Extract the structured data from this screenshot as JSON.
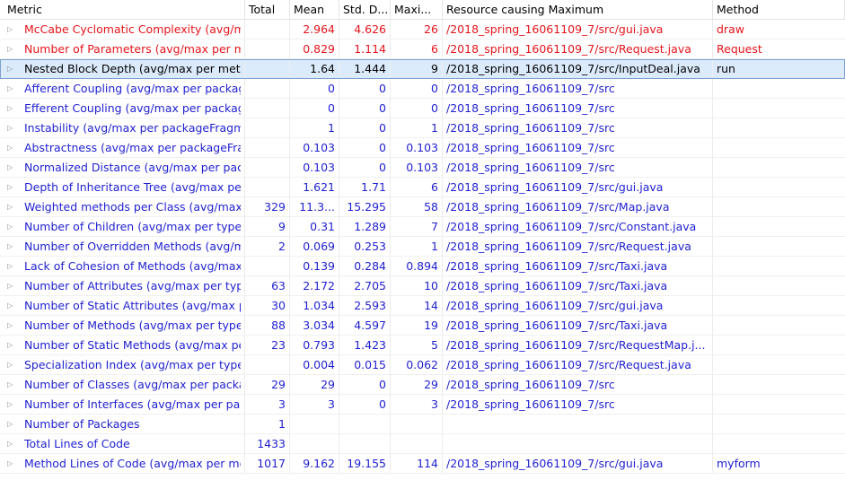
{
  "headers": {
    "metric": "Metric",
    "total": "Total",
    "mean": "Mean",
    "std": "Std. D...",
    "max": "Maxi...",
    "resource": "Resource causing Maximum",
    "method": "Method"
  },
  "rows": [
    {
      "metric": "McCabe Cyclomatic Complexity (avg/max per method)",
      "total": "",
      "mean": "2.964",
      "std": "4.626",
      "max": "26",
      "resource": "/2018_spring_16061109_7/src/gui.java",
      "method": "draw",
      "color": "red"
    },
    {
      "metric": "Number of Parameters (avg/max per method)",
      "total": "",
      "mean": "0.829",
      "std": "1.114",
      "max": "6",
      "resource": "/2018_spring_16061109_7/src/Request.java",
      "method": "Request",
      "color": "red"
    },
    {
      "metric": "Nested Block Depth (avg/max per method)",
      "total": "",
      "mean": "1.64",
      "std": "1.444",
      "max": "9",
      "resource": "/2018_spring_16061109_7/src/InputDeal.java",
      "method": "run",
      "color": "black",
      "selected": true
    },
    {
      "metric": "Afferent Coupling (avg/max per packageFragment)",
      "total": "",
      "mean": "0",
      "std": "0",
      "max": "0",
      "resource": "/2018_spring_16061109_7/src",
      "method": "",
      "color": "blue"
    },
    {
      "metric": "Efferent Coupling (avg/max per packageFragment)",
      "total": "",
      "mean": "0",
      "std": "0",
      "max": "0",
      "resource": "/2018_spring_16061109_7/src",
      "method": "",
      "color": "blue"
    },
    {
      "metric": "Instability (avg/max per packageFragment)",
      "total": "",
      "mean": "1",
      "std": "0",
      "max": "1",
      "resource": "/2018_spring_16061109_7/src",
      "method": "",
      "color": "blue"
    },
    {
      "metric": "Abstractness (avg/max per packageFragment)",
      "total": "",
      "mean": "0.103",
      "std": "0",
      "max": "0.103",
      "resource": "/2018_spring_16061109_7/src",
      "method": "",
      "color": "blue"
    },
    {
      "metric": "Normalized Distance (avg/max per packageFragment)",
      "total": "",
      "mean": "0.103",
      "std": "0",
      "max": "0.103",
      "resource": "/2018_spring_16061109_7/src",
      "method": "",
      "color": "blue"
    },
    {
      "metric": "Depth of Inheritance Tree (avg/max per type)",
      "total": "",
      "mean": "1.621",
      "std": "1.71",
      "max": "6",
      "resource": "/2018_spring_16061109_7/src/gui.java",
      "method": "",
      "color": "blue"
    },
    {
      "metric": "Weighted methods per Class (avg/max per type)",
      "total": "329",
      "mean": "11.3...",
      "std": "15.295",
      "max": "58",
      "resource": "/2018_spring_16061109_7/src/Map.java",
      "method": "",
      "color": "blue"
    },
    {
      "metric": "Number of Children (avg/max per type)",
      "total": "9",
      "mean": "0.31",
      "std": "1.289",
      "max": "7",
      "resource": "/2018_spring_16061109_7/src/Constant.java",
      "method": "",
      "color": "blue"
    },
    {
      "metric": "Number of Overridden Methods (avg/max per type)",
      "total": "2",
      "mean": "0.069",
      "std": "0.253",
      "max": "1",
      "resource": "/2018_spring_16061109_7/src/Request.java",
      "method": "",
      "color": "blue"
    },
    {
      "metric": "Lack of Cohesion of Methods (avg/max per type)",
      "total": "",
      "mean": "0.139",
      "std": "0.284",
      "max": "0.894",
      "resource": "/2018_spring_16061109_7/src/Taxi.java",
      "method": "",
      "color": "blue"
    },
    {
      "metric": "Number of Attributes (avg/max per type)",
      "total": "63",
      "mean": "2.172",
      "std": "2.705",
      "max": "10",
      "resource": "/2018_spring_16061109_7/src/Taxi.java",
      "method": "",
      "color": "blue"
    },
    {
      "metric": "Number of Static Attributes (avg/max per type)",
      "total": "30",
      "mean": "1.034",
      "std": "2.593",
      "max": "14",
      "resource": "/2018_spring_16061109_7/src/gui.java",
      "method": "",
      "color": "blue"
    },
    {
      "metric": "Number of Methods (avg/max per type)",
      "total": "88",
      "mean": "3.034",
      "std": "4.597",
      "max": "19",
      "resource": "/2018_spring_16061109_7/src/Taxi.java",
      "method": "",
      "color": "blue"
    },
    {
      "metric": "Number of Static Methods (avg/max per type)",
      "total": "23",
      "mean": "0.793",
      "std": "1.423",
      "max": "5",
      "resource": "/2018_spring_16061109_7/src/RequestMap.j...",
      "method": "",
      "color": "blue"
    },
    {
      "metric": "Specialization Index (avg/max per type)",
      "total": "",
      "mean": "0.004",
      "std": "0.015",
      "max": "0.062",
      "resource": "/2018_spring_16061109_7/src/Request.java",
      "method": "",
      "color": "blue"
    },
    {
      "metric": "Number of Classes (avg/max per packageFragment)",
      "total": "29",
      "mean": "29",
      "std": "0",
      "max": "29",
      "resource": "/2018_spring_16061109_7/src",
      "method": "",
      "color": "blue"
    },
    {
      "metric": "Number of Interfaces (avg/max per packageFragment)",
      "total": "3",
      "mean": "3",
      "std": "0",
      "max": "3",
      "resource": "/2018_spring_16061109_7/src",
      "method": "",
      "color": "blue"
    },
    {
      "metric": "Number of Packages",
      "total": "1",
      "mean": "",
      "std": "",
      "max": "",
      "resource": "",
      "method": "",
      "color": "blue"
    },
    {
      "metric": "Total Lines of Code",
      "total": "1433",
      "mean": "",
      "std": "",
      "max": "",
      "resource": "",
      "method": "",
      "color": "blue"
    },
    {
      "metric": "Method Lines of Code (avg/max per method)",
      "total": "1017",
      "mean": "9.162",
      "std": "19.155",
      "max": "114",
      "resource": "/2018_spring_16061109_7/src/gui.java",
      "method": "myform",
      "color": "blue"
    }
  ],
  "expander_icon": "expand-triangle-icon"
}
